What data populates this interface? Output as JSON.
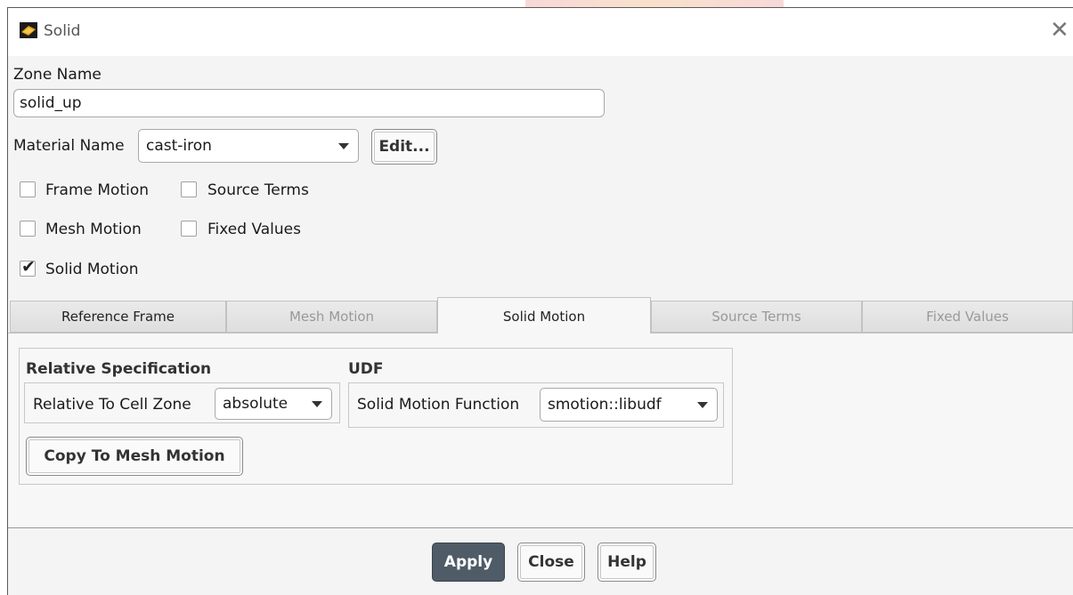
{
  "window": {
    "title": "Solid",
    "close_glyph": "✕"
  },
  "zone": {
    "label": "Zone Name",
    "value": "solid_up"
  },
  "material": {
    "label": "Material Name",
    "value": "cast-iron",
    "edit_label": "Edit..."
  },
  "options": {
    "frame_motion": {
      "label": "Frame Motion",
      "checked": false
    },
    "source_terms": {
      "label": "Source Terms",
      "checked": false
    },
    "mesh_motion": {
      "label": "Mesh Motion",
      "checked": false
    },
    "fixed_values": {
      "label": "Fixed Values",
      "checked": false
    },
    "solid_motion": {
      "label": "Solid Motion",
      "checked": true
    }
  },
  "tabs": [
    {
      "label": "Reference Frame",
      "active": false,
      "enabled": true
    },
    {
      "label": "Mesh Motion",
      "active": false,
      "enabled": false
    },
    {
      "label": "Solid Motion",
      "active": true,
      "enabled": true
    },
    {
      "label": "Source Terms",
      "active": false,
      "enabled": false
    },
    {
      "label": "Fixed Values",
      "active": false,
      "enabled": false
    }
  ],
  "relative_spec": {
    "title": "Relative Specification",
    "cell_zone_label": "Relative To Cell Zone",
    "cell_zone_value": "absolute",
    "copy_button": "Copy To Mesh Motion"
  },
  "udf": {
    "title": "UDF",
    "function_label": "Solid Motion Function",
    "function_value": "smotion::libudf"
  },
  "footer": {
    "apply": "Apply",
    "close": "Close",
    "help": "Help"
  },
  "check_glyph": "✔"
}
